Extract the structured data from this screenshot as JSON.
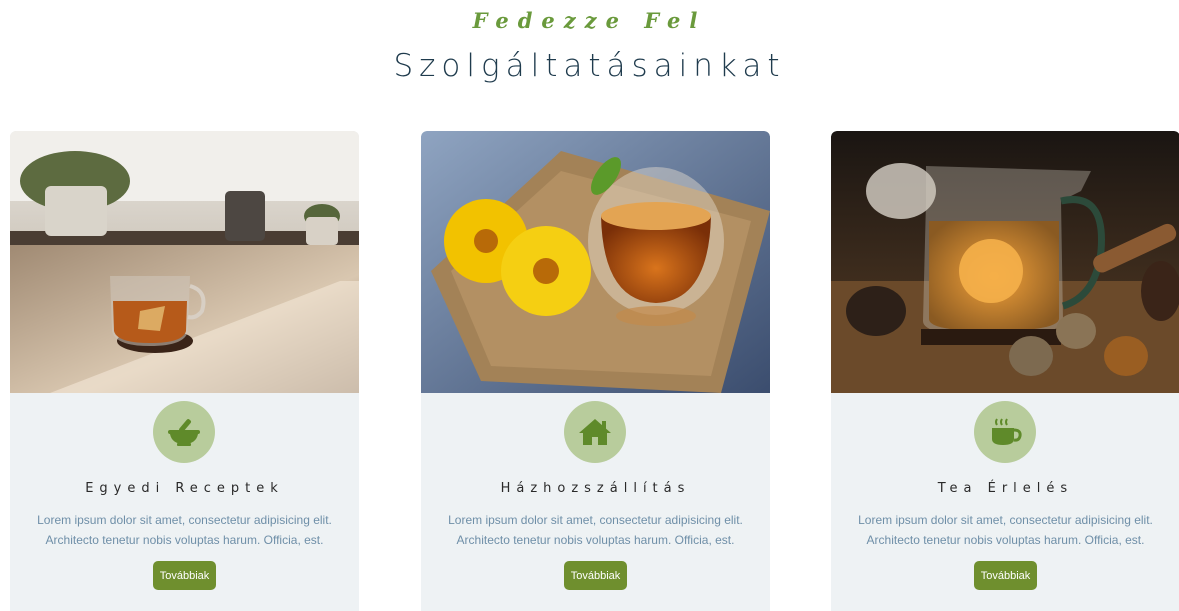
{
  "header": {
    "subtitle": "Fedezze Fel",
    "title": "Szolgáltatásainkat"
  },
  "colors": {
    "accent_green": "#6a9a3c",
    "button_green": "#6f8f2e",
    "icon_circle": "#b8cc9c",
    "card_bg": "#eef2f4",
    "text_blue": "#6f8fa8",
    "title_dark": "#1f3b4d"
  },
  "cards": [
    {
      "icon": "mortar-pestle-icon",
      "image": "tea-cup-on-windowsill-photo",
      "title": "Egyedi Receptek",
      "text": "Lorem ipsum dolor sit amet, consectetur adipisicing elit. Architecto tenetur nobis voluptas harum. Officia, est.",
      "button": "Továbbiak"
    },
    {
      "icon": "home-icon",
      "image": "tea-cup-with-calendula-flowers-photo",
      "title": "Házhozszállítás",
      "text": "Lorem ipsum dolor sit amet, consectetur adipisicing elit. Architecto tenetur nobis voluptas harum. Officia, est.",
      "button": "Továbbiak"
    },
    {
      "icon": "hot-mug-icon",
      "image": "blooming-tea-in-glass-pitcher-photo",
      "title": "Tea Érlelés",
      "text": "Lorem ipsum dolor sit amet, consectetur adipisicing elit. Architecto tenetur nobis voluptas harum. Officia, est.",
      "button": "Továbbiak"
    }
  ]
}
